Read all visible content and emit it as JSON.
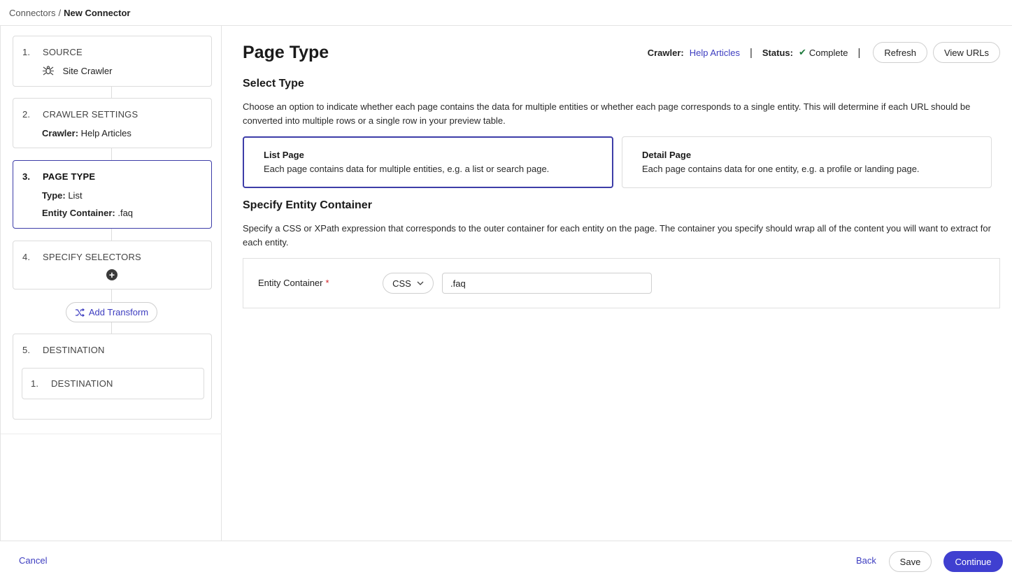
{
  "breadcrumb": {
    "parent": "Connectors",
    "separator": "/",
    "current": "New Connector"
  },
  "sidebar": {
    "steps": [
      {
        "num": "1.",
        "title": "SOURCE",
        "line1": "Site Crawler"
      },
      {
        "num": "2.",
        "title": "CRAWLER SETTINGS",
        "line1_label": "Crawler:",
        "line1_value": " Help Articles"
      },
      {
        "num": "3.",
        "title": "PAGE TYPE",
        "line1_label": "Type:",
        "line1_value": " List",
        "line2_label": "Entity Container:",
        "line2_value": " .faq"
      },
      {
        "num": "4.",
        "title": "SPECIFY SELECTORS"
      },
      {
        "num": "5.",
        "title": "DESTINATION",
        "sub_num": "1.",
        "sub_title": "DESTINATION"
      }
    ],
    "add_transform": "Add Transform",
    "add_selector_icon": "+"
  },
  "main": {
    "title": "Page Type",
    "status": {
      "crawler_label": "Crawler:",
      "crawler_value": "Help Articles",
      "status_label": "Status:",
      "status_value": "Complete",
      "pipe": "|",
      "refresh": "Refresh",
      "view_urls": "View URLs"
    },
    "select_type": {
      "title": "Select Type",
      "desc": "Choose an option to indicate whether each page contains the data for multiple entities or whether each page corresponds to a single entity. This will determine if each URL should be converted into multiple rows or a single row in your preview table.",
      "list_title": "List Page",
      "list_desc": "Each page contains data for multiple entities, e.g. a list or search page.",
      "detail_title": "Detail Page",
      "detail_desc": "Each page contains data for one entity, e.g. a profile or landing page."
    },
    "entity": {
      "title": "Specify Entity Container",
      "desc": "Specify a CSS or XPath expression that corresponds to the outer container for each entity on the page. The container you specify should wrap all of the content you will want to extract for each entity.",
      "label": "Entity Container",
      "required": "*",
      "selector_type": "CSS",
      "value": ".faq"
    }
  },
  "footer": {
    "cancel": "Cancel",
    "back": "Back",
    "save": "Save",
    "continue": "Continue"
  },
  "colors": {
    "accent": "#3f3fd0",
    "link": "#3d3dc0",
    "success": "#1e7a3c",
    "required": "#d2232a"
  }
}
